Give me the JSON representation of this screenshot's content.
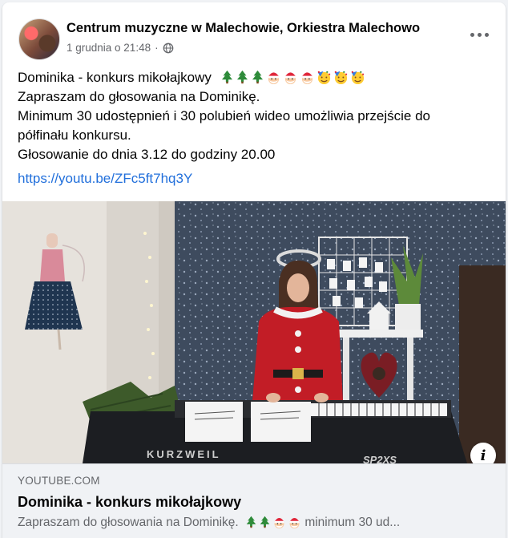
{
  "post": {
    "page_name": "Centrum muzyczne w Malechowie, Orkiestra Malechowo",
    "timestamp": "1 grudnia o 21:48",
    "dot": "·",
    "privacy_icon": "globe-icon",
    "more_icon": "more-options-icon",
    "text_lines": [
      "Dominika - konkurs mikołajkowy",
      "Zapraszam do głosowania na Dominikę.",
      "Minimum 30 udostępnień i 30 polubień wideo umożliwia przejście do",
      "półfinału konkursu.",
      "Głosowanie do dnia 3.12 do godziny 20.00"
    ],
    "emojis_line1": [
      "christmas-tree-emoji",
      "christmas-tree-emoji",
      "christmas-tree-emoji",
      "santa-emoji",
      "santa-emoji",
      "santa-emoji",
      "party-face-emoji",
      "party-face-emoji",
      "party-face-emoji"
    ],
    "link": "https://youtu.be/ZFc5ft7hq3Y"
  },
  "video": {
    "keyboard_brand": "KURZWEIL",
    "keyboard_model": "SP2XS",
    "info_icon": "info-icon",
    "info_label": "i"
  },
  "link_preview": {
    "domain": "YOUTUBE.COM",
    "title": "Dominika - konkurs mikołajkowy",
    "description": "Zapraszam do głosowania na Dominikę.",
    "description_suffix": "minimum 30 ud...",
    "emojis": [
      "christmas-tree-emoji",
      "christmas-tree-emoji",
      "santa-emoji",
      "santa-emoji"
    ]
  },
  "colors": {
    "link": "#216fdb",
    "secondary_text": "#65676b",
    "background": "#f0f2f5"
  }
}
